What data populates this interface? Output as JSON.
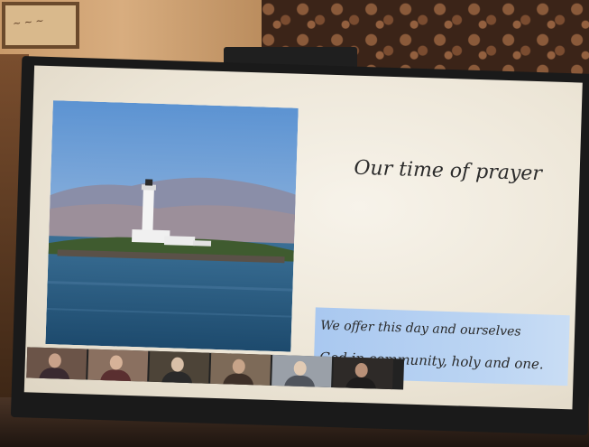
{
  "slide": {
    "title": "Our time of prayer",
    "caption_line_1": "We offer this day and ourselves",
    "caption_line_2": "God in community, holy and one."
  },
  "photo_subject": "lighthouse-on-island",
  "colors": {
    "screen_background": "#f2ede2",
    "caption_highlight": "#b5d0f2",
    "title_text": "#2b2b2b"
  },
  "video_participants": [
    {
      "id": "participant-1",
      "bg": "#6b5448",
      "head": "#c9a28a",
      "body": "#3a2a30"
    },
    {
      "id": "participant-2",
      "bg": "#8a7060",
      "head": "#d6b298",
      "body": "#5a2f30"
    },
    {
      "id": "participant-3",
      "bg": "#4d4438",
      "head": "#d9c0a8",
      "body": "#2a2a2a"
    },
    {
      "id": "participant-4",
      "bg": "#7d6a58",
      "head": "#c7a489",
      "body": "#3e3028"
    },
    {
      "id": "participant-5",
      "bg": "#9aa0a8",
      "head": "#e2cbb4",
      "body": "#50545c"
    },
    {
      "id": "participant-6",
      "bg": "#2e2a28",
      "head": "#b89078",
      "body": "#1e1c1c"
    }
  ]
}
